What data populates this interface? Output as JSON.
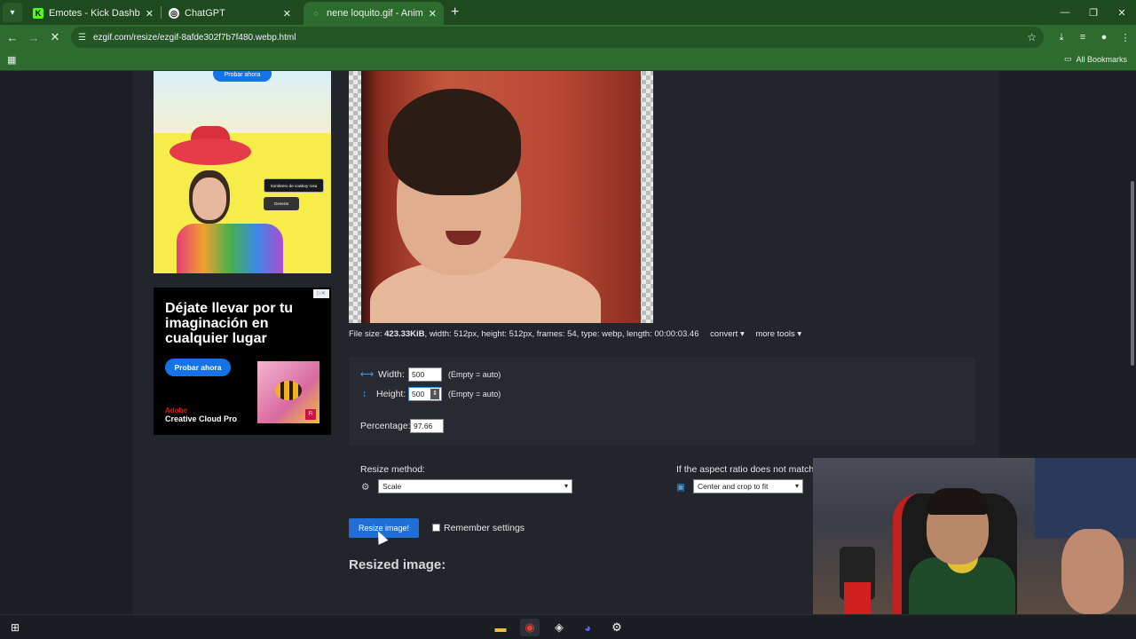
{
  "browser": {
    "tabs": [
      {
        "label": "Emotes - Kick Dashboard",
        "icon": "kick-icon",
        "active": false
      },
      {
        "label": "ChatGPT",
        "icon": "chatgpt-icon",
        "active": false
      },
      {
        "label": "nene loquito.gif - Animated im",
        "icon": "loading-icon",
        "active": true
      }
    ],
    "url": "ezgif.com/resize/ezgif-8afde302f7b7f480.webp.html",
    "bookmarks_label": "All Bookmarks"
  },
  "ads": {
    "top_ad": {
      "button": "Probar ahora",
      "chip1": "Sombrero de cowboy rosa",
      "chip2": "Generar"
    },
    "bottom_ad": {
      "headline": "Déjate llevar por tu imaginación en cualquier lugar",
      "cta": "Probar ahora",
      "brand_small": "Adobe",
      "brand": "Creative Cloud Pro"
    }
  },
  "file_info": {
    "prefix": "File size: ",
    "size": "423.33KiB",
    "rest": ", width: 512px, height: 512px, frames: 54, type: webp, length: 00:00:03.46",
    "convert": "convert ▾",
    "more_tools": "more tools ▾"
  },
  "form": {
    "width_label": "Width:",
    "width_value": "500",
    "width_hint": "(Empty = auto)",
    "height_label": "Height:",
    "height_value": "500",
    "height_hint": "(Empty = auto)",
    "percentage_label": "Percentage:",
    "percentage_value": "97.66",
    "resize_method_label": "Resize method:",
    "resize_method_value": "Scale",
    "aspect_label": "If the aspect ratio does not match:",
    "aspect_value": "Center and crop to fit",
    "resize_button": "Resize image!",
    "remember_label": "Remember settings"
  },
  "result_heading": "Resized image:",
  "colors": {
    "chrome_green": "#2e6b2e",
    "tabbar_green": "#1f4a1f",
    "page_bg": "#22252b",
    "button_blue": "#1f6fd6"
  }
}
